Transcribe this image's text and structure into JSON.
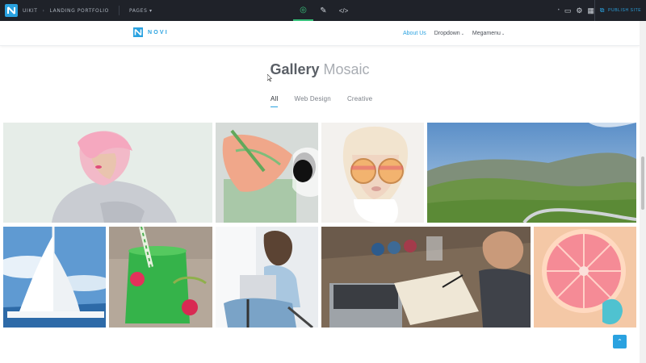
{
  "editor": {
    "breadcrumb": [
      "UIKIT",
      "LANDING PORTFOLIO"
    ],
    "pages_label": "PAGES",
    "pages_chevron": "▾",
    "modes": [
      {
        "name": "design-mode",
        "icon": "compass-icon",
        "glyph": "◎",
        "active": true
      },
      {
        "name": "edit-mode",
        "icon": "pencil-square-icon",
        "glyph": "✎",
        "active": false
      },
      {
        "name": "code-mode",
        "icon": "code-icon",
        "glyph": "</>",
        "active": false
      }
    ],
    "tools": [
      {
        "icon": "desktop-icon",
        "glyph": "▭"
      },
      {
        "icon": "gear-icon",
        "glyph": "⚙"
      },
      {
        "icon": "calendar-icon",
        "glyph": "▦"
      }
    ],
    "publish_label": "PUBLISH SITE",
    "accent": "#2aa2e0",
    "active_mode_color": "#37c27b"
  },
  "site": {
    "brand": "NOVI",
    "nav": [
      {
        "label": "About Us",
        "active": true,
        "has_dropdown": false
      },
      {
        "label": "Dropdown",
        "active": false,
        "has_dropdown": true
      },
      {
        "label": "Megamenu",
        "active": false,
        "has_dropdown": true
      }
    ]
  },
  "gallery": {
    "title_bold": "Gallery",
    "title_light": "Mosaic",
    "filters": [
      {
        "label": "All",
        "active": true
      },
      {
        "label": "Web Design",
        "active": false
      },
      {
        "label": "Creative",
        "active": false
      }
    ],
    "images": [
      "woman-pink-hair",
      "anthurium-flower-sunglasses",
      "woman-round-sunglasses",
      "mountain-road-landscape",
      "sailboat-mast-sky",
      "green-smoothie-raspberries",
      "woman-laptop-jeans",
      "man-drawing-desk",
      "grapefruit-slice"
    ]
  },
  "back_to_top": {
    "icon": "chevron-up-icon",
    "glyph": "⌃"
  }
}
